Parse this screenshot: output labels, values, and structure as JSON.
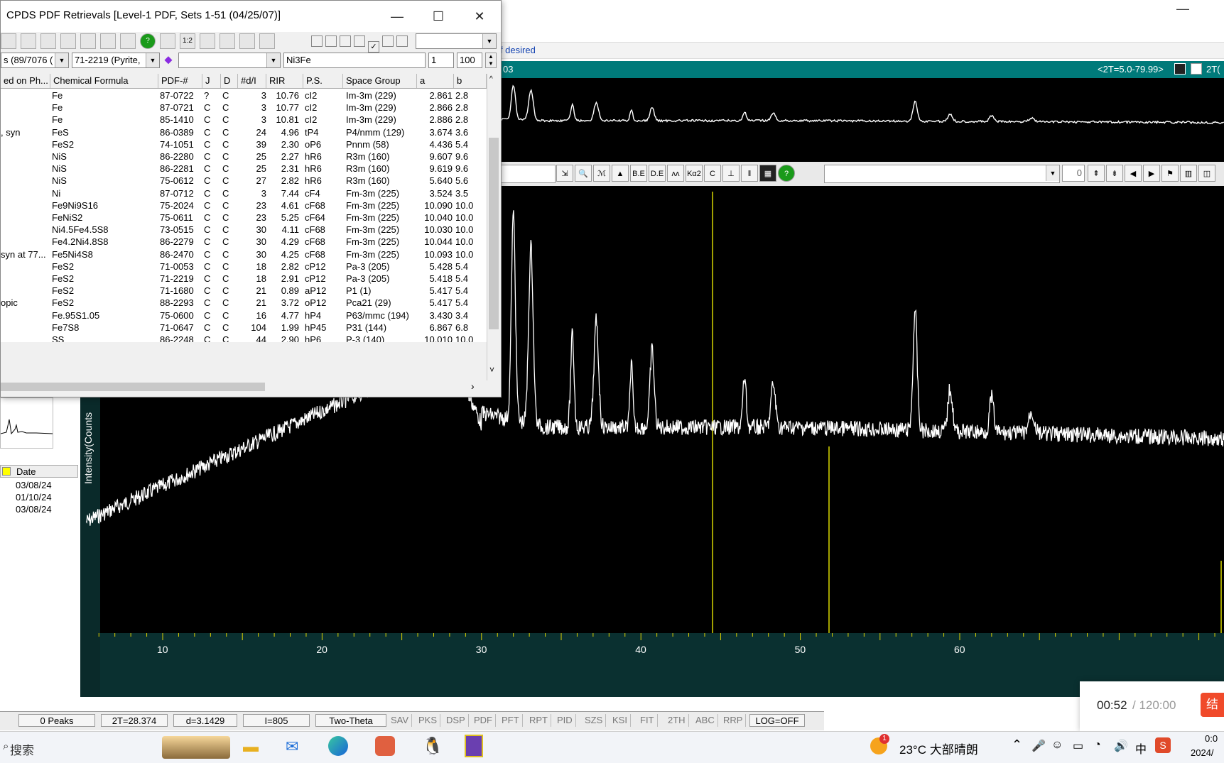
{
  "dialog": {
    "title": "CPDS PDF Retrievals [Level-1 PDF, Sets 1-51 (04/25/07)]",
    "minimize": "—",
    "maximize": "☐",
    "close": "✕",
    "toolbar_icons": [
      "sigma-icon",
      "percent-icon",
      "print-icon",
      "save-icon",
      "copy-icon",
      "list-icon",
      "open-icon",
      "help-icon",
      "view-icon",
      "ratio-icon",
      "window-icon",
      "color-icon",
      "star-icon",
      "arrows-icon",
      "checkbox-row"
    ],
    "toolbar_ratio_label": "1:2",
    "filter": {
      "hits": "s (89/7076 (",
      "phase": "71-2219 (Pyrite,",
      "formula": "Ni3Fe",
      "from": "1",
      "to": "100"
    },
    "columns": [
      "ed on Ph...",
      "Chemical Formula",
      "PDF-#",
      "J",
      "D",
      "#d/I",
      "RIR",
      "P.S.",
      "Space Group",
      "a",
      "b"
    ],
    "rows": [
      {
        "name": "",
        "formula": "Fe",
        "pdf": "87-0722",
        "j": "?",
        "d": "C",
        "di": "3",
        "rir": "10.76",
        "ps": "cI2",
        "sg": "Im-3m (229)",
        "a": "2.861",
        "b": "2.8"
      },
      {
        "name": "",
        "formula": "Fe",
        "pdf": "87-0721",
        "j": "C",
        "d": "C",
        "di": "3",
        "rir": "10.77",
        "ps": "cI2",
        "sg": "Im-3m (229)",
        "a": "2.866",
        "b": "2.8"
      },
      {
        "name": "",
        "formula": "Fe",
        "pdf": "85-1410",
        "j": "C",
        "d": "C",
        "di": "3",
        "rir": "10.81",
        "ps": "cI2",
        "sg": "Im-3m (229)",
        "a": "2.886",
        "b": "2.8"
      },
      {
        "name": ", syn",
        "formula": "FeS",
        "pdf": "86-0389",
        "j": "C",
        "d": "C",
        "di": "24",
        "rir": "4.96",
        "ps": "tP4",
        "sg": "P4/nmm (129)",
        "a": "3.674",
        "b": "3.6"
      },
      {
        "name": "",
        "formula": "FeS2",
        "pdf": "74-1051",
        "j": "C",
        "d": "C",
        "di": "39",
        "rir": "2.30",
        "ps": "oP6",
        "sg": "Pnnm (58)",
        "a": "4.436",
        "b": "5.4"
      },
      {
        "name": "",
        "formula": "NiS",
        "pdf": "86-2280",
        "j": "C",
        "d": "C",
        "di": "25",
        "rir": "2.27",
        "ps": "hR6",
        "sg": "R3m (160)",
        "a": "9.607",
        "b": "9.6"
      },
      {
        "name": "",
        "formula": "NiS",
        "pdf": "86-2281",
        "j": "C",
        "d": "C",
        "di": "25",
        "rir": "2.31",
        "ps": "hR6",
        "sg": "R3m (160)",
        "a": "9.619",
        "b": "9.6"
      },
      {
        "name": "",
        "formula": "NiS",
        "pdf": "75-0612",
        "j": "C",
        "d": "C",
        "di": "27",
        "rir": "2.82",
        "ps": "hR6",
        "sg": "R3m (160)",
        "a": "5.640",
        "b": "5.6"
      },
      {
        "name": "",
        "formula": "Ni",
        "pdf": "87-0712",
        "j": "C",
        "d": "C",
        "di": "3",
        "rir": "7.44",
        "ps": "cF4",
        "sg": "Fm-3m (225)",
        "a": "3.524",
        "b": "3.5"
      },
      {
        "name": "",
        "formula": "Fe9Ni9S16",
        "pdf": "75-2024",
        "j": "C",
        "d": "C",
        "di": "23",
        "rir": "4.61",
        "ps": "cF68",
        "sg": "Fm-3m (225)",
        "a": "10.090",
        "b": "10.0"
      },
      {
        "name": "",
        "formula": "FeNiS2",
        "pdf": "75-0611",
        "j": "C",
        "d": "C",
        "di": "23",
        "rir": "5.25",
        "ps": "cF64",
        "sg": "Fm-3m (225)",
        "a": "10.040",
        "b": "10.0"
      },
      {
        "name": "",
        "formula": "Ni4.5Fe4.5S8",
        "pdf": "73-0515",
        "j": "C",
        "d": "C",
        "di": "30",
        "rir": "4.11",
        "ps": "cF68",
        "sg": "Fm-3m (225)",
        "a": "10.030",
        "b": "10.0"
      },
      {
        "name": "",
        "formula": "Fe4.2Ni4.8S8",
        "pdf": "86-2279",
        "j": "C",
        "d": "C",
        "di": "30",
        "rir": "4.29",
        "ps": "cF68",
        "sg": "Fm-3m (225)",
        "a": "10.044",
        "b": "10.0"
      },
      {
        "name": "syn at 77...",
        "formula": "Fe5Ni4S8",
        "pdf": "86-2470",
        "j": "C",
        "d": "C",
        "di": "30",
        "rir": "4.25",
        "ps": "cF68",
        "sg": "Fm-3m (225)",
        "a": "10.093",
        "b": "10.0"
      },
      {
        "name": "",
        "formula": "FeS2",
        "pdf": "71-0053",
        "j": "C",
        "d": "C",
        "di": "18",
        "rir": "2.82",
        "ps": "cP12",
        "sg": "Pa-3 (205)",
        "a": "5.428",
        "b": "5.4"
      },
      {
        "name": "",
        "formula": "FeS2",
        "pdf": "71-2219",
        "j": "C",
        "d": "C",
        "di": "18",
        "rir": "2.91",
        "ps": "cP12",
        "sg": "Pa-3 (205)",
        "a": "5.418",
        "b": "5.4"
      },
      {
        "name": "",
        "formula": "FeS2",
        "pdf": "71-1680",
        "j": "C",
        "d": "C",
        "di": "21",
        "rir": "0.89",
        "ps": "aP12",
        "sg": "P1 (1)",
        "a": "5.417",
        "b": "5.4"
      },
      {
        "name": "opic",
        "formula": "FeS2",
        "pdf": "88-2293",
        "j": "C",
        "d": "C",
        "di": "21",
        "rir": "3.72",
        "ps": "oP12",
        "sg": "Pca21 (29)",
        "a": "5.417",
        "b": "5.4"
      },
      {
        "name": "",
        "formula": "Fe.95S1.05",
        "pdf": "75-0600",
        "j": "C",
        "d": "C",
        "di": "16",
        "rir": "4.77",
        "ps": "hP4",
        "sg": "P63/mmc (194)",
        "a": "3.430",
        "b": "3.4"
      },
      {
        "name": "",
        "formula": "Fe7S8",
        "pdf": "71-0647",
        "j": "C",
        "d": "C",
        "di": "104",
        "rir": "1.99",
        "ps": "hP45",
        "sg": "P31 (144)",
        "a": "6.867",
        "b": "6.8"
      },
      {
        "name": "",
        "formula": "SS",
        "pdf": "86-2248",
        "j": "C",
        "d": "C",
        "di": "44",
        "rir": "2.90",
        "ps": "hP6",
        "sg": "P-3 (140)",
        "a": "10.010",
        "b": "10.0"
      }
    ]
  },
  "app": {
    "hint": "og if desired",
    "top_header_left": "03",
    "top_header_range": "<2T=5.0-79.99>",
    "top_header_right": "2T(",
    "toolbar": {
      "labels": [
        "B.E",
        "D.E",
        "Kα2",
        "C"
      ],
      "value": "0"
    },
    "ylabel": "Intensity(Counts",
    "xticks": [
      "10",
      "20",
      "30",
      "40",
      "50",
      "60"
    ],
    "left_list": {
      "header": "Date",
      "dates": [
        "03/08/24",
        "01/10/24",
        "03/08/24"
      ]
    },
    "status": {
      "peaks": "0 Peaks",
      "two_theta": "2T=28.374",
      "d": "d=3.1429",
      "i": "I=805",
      "mode": "Two-Theta",
      "buttons": [
        "SAV",
        "PKS",
        "DSP",
        "PDF",
        "PFT",
        "RPT",
        "PID",
        "SZS",
        "KSI",
        "FIT",
        "2TH",
        "ABC",
        "RRP"
      ],
      "log": "LOG=OFF"
    }
  },
  "chart_data": {
    "type": "line",
    "title": "",
    "xlabel": "",
    "ylabel": "Intensity(Counts",
    "xlim": [
      5,
      80
    ],
    "peaks_2theta": [
      32.0,
      33.1,
      35.7,
      37.2,
      39.4,
      40.7,
      46.5,
      48.3,
      57.2,
      59.4,
      62.0,
      64.5
    ],
    "reference_lines_2theta": [
      44.5,
      51.8,
      76.4
    ]
  },
  "taskbar": {
    "search": "搜索",
    "weather": "23°C  大部晴朗",
    "ime": "中",
    "time": "0:0",
    "date": "2024/",
    "badge": "1"
  },
  "timer": {
    "elapsed": "00:52",
    "total": "/ 120:00",
    "button": "结"
  }
}
